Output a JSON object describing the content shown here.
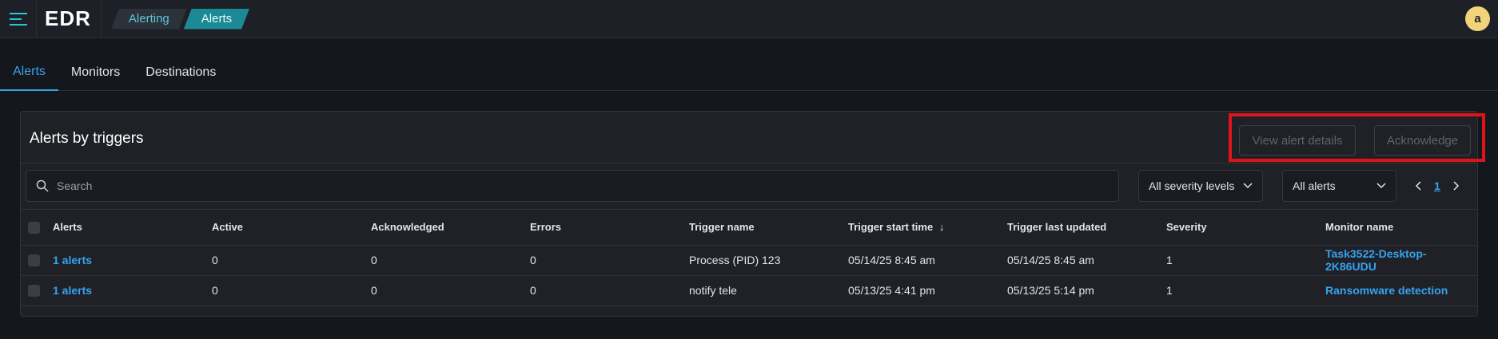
{
  "header": {
    "logo": "EDR",
    "breadcrumbs": [
      "Alerting",
      "Alerts"
    ],
    "avatar_initial": "a"
  },
  "tabs": [
    {
      "label": "Alerts",
      "active": true
    },
    {
      "label": "Monitors",
      "active": false
    },
    {
      "label": "Destinations",
      "active": false
    }
  ],
  "panel": {
    "title": "Alerts by triggers",
    "view_details_label": "View alert details",
    "acknowledge_label": "Acknowledge"
  },
  "toolbar": {
    "search_placeholder": "Search",
    "severity_select": "All severity levels",
    "alerts_select": "All alerts",
    "page": "1"
  },
  "table": {
    "columns": [
      "Alerts",
      "Active",
      "Acknowledged",
      "Errors",
      "Trigger name",
      "Trigger start time",
      "Trigger last updated",
      "Severity",
      "Monitor name"
    ],
    "rows": [
      {
        "alerts": "1 alerts",
        "active": "0",
        "acknowledged": "0",
        "errors": "0",
        "trigger_name": "Process (PID) 123",
        "start": "05/14/25 8:45 am",
        "updated": "05/14/25 8:45 am",
        "severity": "1",
        "monitor": "Task3522-Desktop-2K86UDU"
      },
      {
        "alerts": "1 alerts",
        "active": "0",
        "acknowledged": "0",
        "errors": "0",
        "trigger_name": "notify tele",
        "start": "05/13/25 4:41 pm",
        "updated": "05/13/25 5:14 pm",
        "severity": "1",
        "monitor": "Ransomware detection"
      }
    ]
  },
  "colors": {
    "accent": "#36a2ef",
    "teal": "#1b8a96",
    "highlight_box": "#e0121a"
  }
}
